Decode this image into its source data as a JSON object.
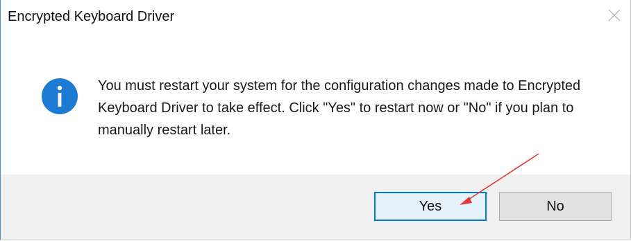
{
  "window": {
    "title": "Encrypted Keyboard Driver",
    "close_icon": "close-icon"
  },
  "dialog": {
    "icon": "info-icon",
    "message": "You must restart your system for the configuration changes made to Encrypted Keyboard Driver to take effect. Click \"Yes\" to restart now or \"No\" if you plan to manually restart later."
  },
  "buttons": {
    "yes_label": "Yes",
    "no_label": "No"
  },
  "annotation": {
    "arrow_color": "#e53935",
    "accent": "#0078d7",
    "icon_color": "#1e7bd3"
  }
}
